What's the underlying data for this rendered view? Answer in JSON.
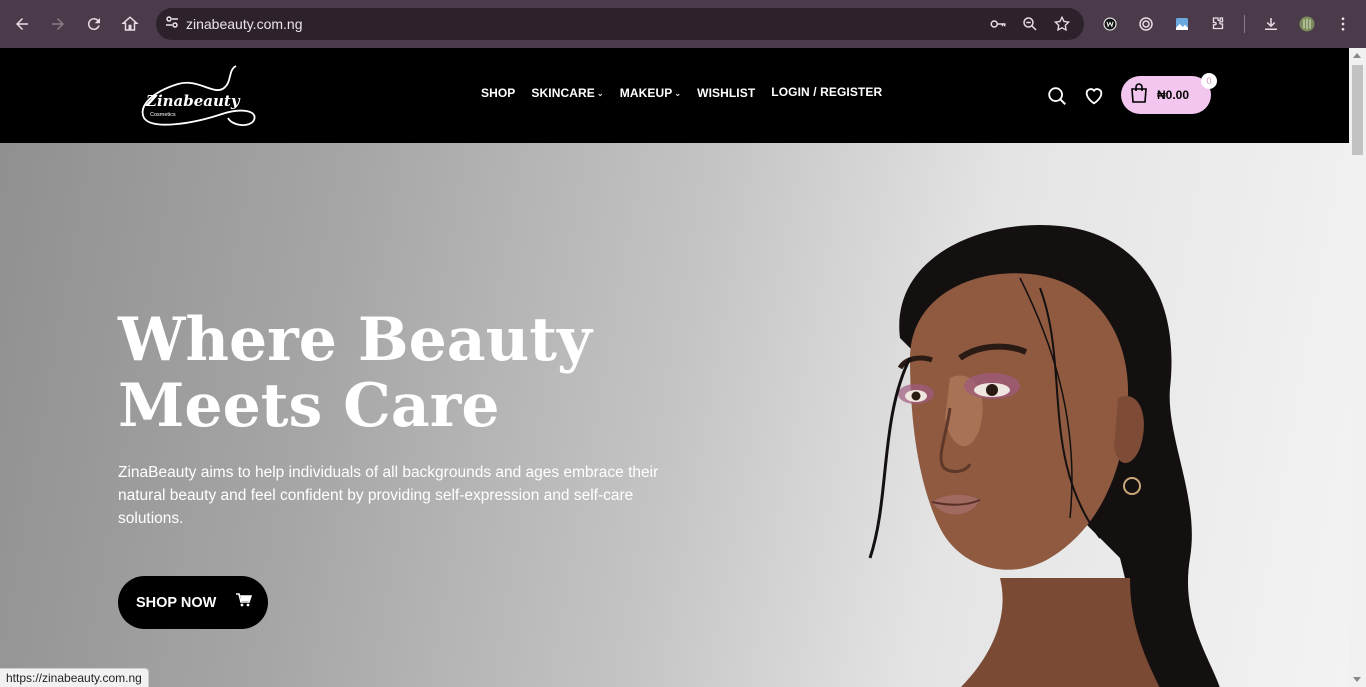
{
  "browser": {
    "url": "zinabeauty.com.ng",
    "status_url": "https://zinabeauty.com.ng"
  },
  "site": {
    "logo_text": "Zinabeauty",
    "logo_subtext": "Cosmetics",
    "menu": [
      {
        "label": "SHOP",
        "has_dropdown": false
      },
      {
        "label": "SKINCARE",
        "has_dropdown": true
      },
      {
        "label": "MAKEUP",
        "has_dropdown": true
      },
      {
        "label": "WISHLIST",
        "has_dropdown": false
      },
      {
        "label": "LOGIN / REGISTER",
        "has_dropdown": false
      }
    ],
    "cart": {
      "amount": "₦0.00",
      "count": "0"
    },
    "colors": {
      "header_bg": "#000000",
      "cart_pill": "#f2c6ee",
      "button_bg": "#000000"
    }
  },
  "hero": {
    "title_line1": "Where Beauty",
    "title_line2": "Meets Care",
    "description": "ZinaBeauty aims to help individuals of all backgrounds and ages embrace their natural beauty and feel confident by providing self-expression and self-care solutions.",
    "cta_label": "SHOP NOW"
  }
}
